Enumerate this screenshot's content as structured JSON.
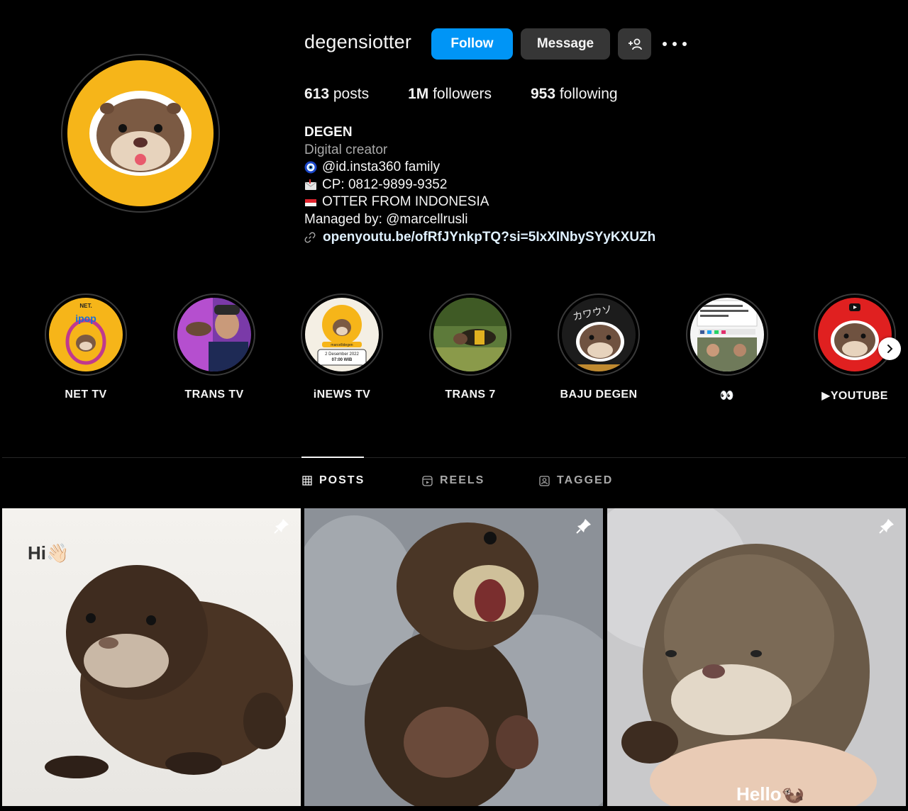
{
  "profile": {
    "username": "degensiotter",
    "follow_label": "Follow",
    "message_label": "Message",
    "stats": {
      "posts": "613",
      "posts_label": " posts",
      "followers": "1M",
      "followers_label": " followers",
      "following": "953",
      "following_label": " following"
    },
    "bio": {
      "name": "DEGEN",
      "category": "Digital creator",
      "line1": "@id.insta360 family",
      "line2": "CP: 0812-9899-9352",
      "line3": "OTTER FROM INDONESIA",
      "line4": "Managed by: @marcellrusli",
      "link": "openyoutu.be/ofRfJYnkpTQ?si=5IxXINbySYyKXUZh"
    }
  },
  "highlights": [
    {
      "label": "NET TV"
    },
    {
      "label": "TRANS TV"
    },
    {
      "label": "iNEWS TV"
    },
    {
      "label": "TRANS 7"
    },
    {
      "label": "BAJU DEGEN"
    },
    {
      "label": "👀"
    },
    {
      "label": "▶YOUTUBE"
    }
  ],
  "highlight_texts": {
    "net_logo": "NET.",
    "ipop": "ipop",
    "inews_handle": "marcellidegen",
    "inews_date": "2 Desember 2022",
    "inews_time": "07:00 WIB",
    "baju_text": "カワウソ"
  },
  "tabs": {
    "posts": "POSTS",
    "reels": "REELS",
    "tagged": "TAGGED",
    "active": "posts"
  },
  "posts": [
    {
      "overlay": "Hi👋🏻",
      "pinned": true
    },
    {
      "overlay": "",
      "pinned": true
    },
    {
      "overlay": "Hello🦦",
      "pinned": true
    }
  ],
  "colors": {
    "background": "#000000",
    "follow_button": "#0095f6",
    "secondary_button": "#363636",
    "avatar_bg": "#f6b519",
    "link": "#e0f1ff"
  }
}
